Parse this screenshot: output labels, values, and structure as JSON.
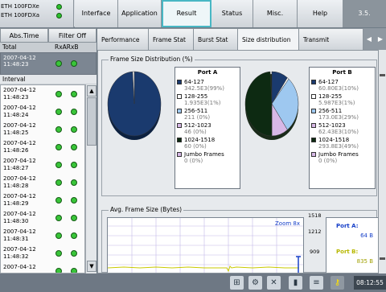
{
  "ports": [
    {
      "name": "ETH 100FDXe"
    },
    {
      "name": "ETH 100FDXa"
    }
  ],
  "main_tabs": [
    {
      "label": "Interface"
    },
    {
      "label": "Application"
    },
    {
      "label": "Result"
    },
    {
      "label": "Status"
    },
    {
      "label": "Misc."
    },
    {
      "label": "Help"
    },
    {
      "label": "3.5."
    }
  ],
  "left_panel": {
    "tabs": [
      {
        "label": "Abs.Time"
      },
      {
        "label": "Filter Off"
      }
    ],
    "total_label": "Total",
    "rx_header": "RxARxB",
    "total_time": {
      "date": "2007-04-12",
      "time": "11:48:23"
    },
    "interval_label": "Interval",
    "intervals": [
      {
        "date": "2007-04-12",
        "time": "11:48:23"
      },
      {
        "date": "2007-04-12",
        "time": "11:48:24"
      },
      {
        "date": "2007-04-12",
        "time": "11:48:25"
      },
      {
        "date": "2007-04-12",
        "time": "11:48:26"
      },
      {
        "date": "2007-04-12",
        "time": "11:48:27"
      },
      {
        "date": "2007-04-12",
        "time": "11:48:28"
      },
      {
        "date": "2007-04-12",
        "time": "11:48:29"
      },
      {
        "date": "2007-04-12",
        "time": "11:48:30"
      },
      {
        "date": "2007-04-12",
        "time": "11:48:31"
      },
      {
        "date": "2007-04-12",
        "time": "11:48:32"
      },
      {
        "date": "2007-04-12",
        "time": ""
      }
    ]
  },
  "sub_tabs": [
    {
      "label": "Performance"
    },
    {
      "label": "Frame Stat"
    },
    {
      "label": "Burst Stat"
    },
    {
      "label": "Size distribution"
    },
    {
      "label": "Transmit"
    }
  ],
  "frame_size_distribution": {
    "title": "Frame Size Distribution (%)",
    "port_a": {
      "title": "Port A",
      "items": [
        {
          "label": "64-127",
          "value": "342.5E3(99%)",
          "color": "#1a3a6e",
          "fraction": 0.99
        },
        {
          "label": "128-255",
          "value": "1.935E3(1%)",
          "color": "#ffffff",
          "fraction": 0.01
        },
        {
          "label": "256-511",
          "value": "211 (0%)",
          "color": "#9ec8f0",
          "fraction": 0.0
        },
        {
          "label": "512-1023",
          "value": "46 (0%)",
          "color": "#d7b8e6",
          "fraction": 0.0
        },
        {
          "label": "1024-1518",
          "value": "60 (0%)",
          "color": "#0d2a12",
          "fraction": 0.0
        },
        {
          "label": "Jumbo Frames",
          "value": "0 (0%)",
          "color": "#d7b8e6",
          "fraction": 0.0
        }
      ]
    },
    "port_b": {
      "title": "Port B",
      "items": [
        {
          "label": "64-127",
          "value": "60.80E3(10%)",
          "color": "#1a3a6e",
          "fraction": 0.1
        },
        {
          "label": "128-255",
          "value": "5.987E3(1%)",
          "color": "#ffffff",
          "fraction": 0.01
        },
        {
          "label": "256-511",
          "value": "173.0E3(29%)",
          "color": "#9ec8f0",
          "fraction": 0.29
        },
        {
          "label": "512-1023",
          "value": "62.43E3(10%)",
          "color": "#d7b8e6",
          "fraction": 0.1
        },
        {
          "label": "1024-1518",
          "value": "293.8E3(49%)",
          "color": "#0d2a12",
          "fraction": 0.49
        },
        {
          "label": "Jumbo Frames",
          "value": "0 (0%)",
          "color": "#d7b8e6",
          "fraction": 0.0
        }
      ]
    }
  },
  "avg_frame_size": {
    "title": "Avg. Frame Size (Bytes)",
    "zoom_label": "Zoom 8x",
    "y_ticks": [
      "1518",
      "1212",
      "909"
    ],
    "port_a_label": "Port A:",
    "port_a_value": "64 B",
    "port_b_label": "Port B:",
    "port_b_value": "835 B",
    "port_a_color": "#1740c9",
    "port_b_color": "#c9c900"
  },
  "status_bar": {
    "icons": [
      "network-icon",
      "settings-icon",
      "tools-icon",
      "chart-icon",
      "list-icon",
      "key-icon"
    ],
    "clock": "08:12:55"
  }
}
